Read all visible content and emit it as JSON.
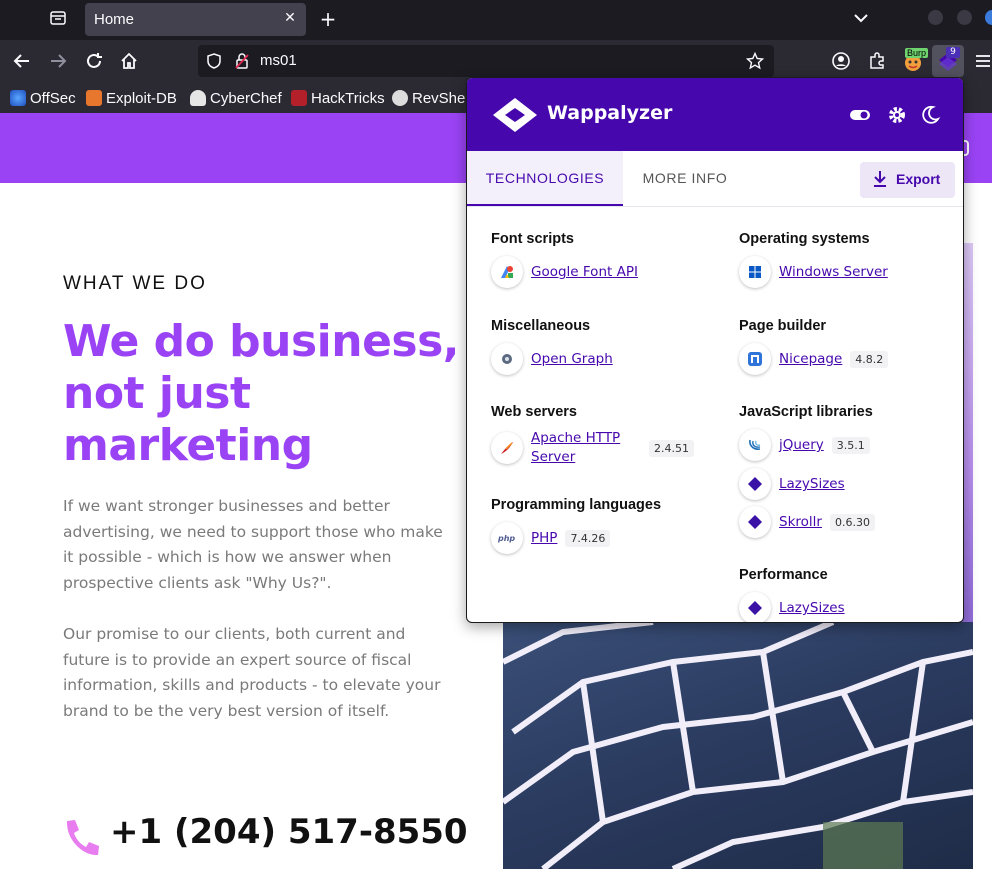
{
  "browser": {
    "tab_title": "Home",
    "url": "ms01",
    "extension_badge": "9",
    "burp_label": "Burp",
    "bookmarks": [
      "OffSec",
      "Exploit-DB",
      "CyberChef",
      "HackTricks",
      "RevShell"
    ]
  },
  "page": {
    "eyebrow": "WHAT WE DO",
    "headline": "We do business, not just marketing",
    "para1": "If we want stronger businesses and better advertising, we need to support those who make it possible - which is how we answer when prospective clients ask \"Why Us?\".",
    "para2": "Our promise to our clients, both current and future is to provide an expert source of fiscal information, skills and products - to elevate your brand to be the very best version of itself.",
    "phone": "+1 (204) 517-8550",
    "accent_color": "#9a43f5"
  },
  "wappalyzer": {
    "title": "Wappalyzer",
    "tabs": [
      "TECHNOLOGIES",
      "MORE INFO"
    ],
    "export_label": "Export",
    "brand_color": "#4608ad",
    "categories": {
      "font_scripts": {
        "label": "Font scripts",
        "items": [
          {
            "name": "Google Font API",
            "icon": "google-font-icon"
          }
        ]
      },
      "misc": {
        "label": "Miscellaneous",
        "items": [
          {
            "name": "Open Graph",
            "icon": "open-graph-icon"
          }
        ]
      },
      "web_servers": {
        "label": "Web servers",
        "items": [
          {
            "name": "Apache HTTP Server",
            "version": "2.4.51",
            "icon": "apache-feather-icon"
          }
        ]
      },
      "prog_langs": {
        "label": "Programming languages",
        "items": [
          {
            "name": "PHP",
            "version": "7.4.26",
            "icon": "php-icon"
          }
        ]
      },
      "os": {
        "label": "Operating systems",
        "items": [
          {
            "name": "Windows Server",
            "icon": "windows-icon"
          }
        ]
      },
      "page_builder": {
        "label": "Page builder",
        "items": [
          {
            "name": "Nicepage",
            "version": "4.8.2",
            "icon": "nicepage-icon"
          }
        ]
      },
      "js_libs": {
        "label": "JavaScript libraries",
        "items": [
          {
            "name": "jQuery",
            "version": "3.5.1",
            "icon": "jquery-icon"
          },
          {
            "name": "LazySizes",
            "icon": "lazysizes-icon"
          },
          {
            "name": "Skrollr",
            "version": "0.6.30",
            "icon": "skrollr-icon"
          }
        ]
      },
      "performance": {
        "label": "Performance",
        "items": [
          {
            "name": "LazySizes",
            "icon": "lazysizes-icon"
          }
        ]
      }
    }
  }
}
